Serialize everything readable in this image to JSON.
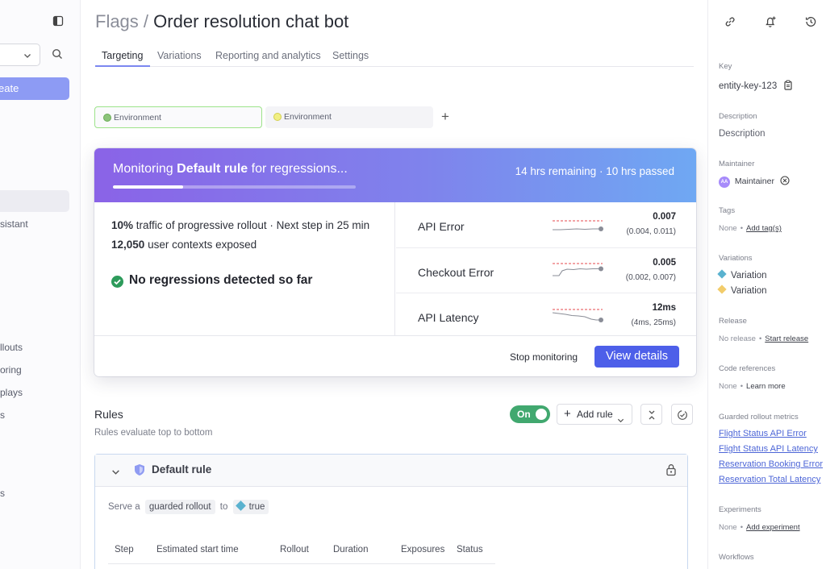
{
  "sidebar": {
    "create_label": "eate",
    "items": [
      "sistant",
      "llouts",
      "oring",
      "plays",
      "s",
      "s"
    ]
  },
  "header": {
    "breadcrumb": "Flags /",
    "title": "Order resolution chat bot",
    "tabs": [
      "Targeting",
      "Variations",
      "Reporting and analytics",
      "Settings"
    ]
  },
  "environments": [
    {
      "label": "Environment",
      "color": "#8cc47a"
    },
    {
      "label": "Environment",
      "color": "#f1ef83"
    }
  ],
  "monitoring": {
    "title_prefix": "Monitoring",
    "title_bold": "Default rule",
    "title_suffix": "for regressions...",
    "remaining": "14 hrs remaining · 10 hrs passed",
    "progress": 0.29,
    "traffic_bold": "10%",
    "traffic_text": "traffic of progressive rollout · Next step in 25 min",
    "contexts_bold": "12,050",
    "contexts_text": "user contexts exposed",
    "status": "No regressions detected so far",
    "metrics": [
      {
        "name": "API Error",
        "value": "0.007",
        "ci": "(0.004, 0.011)"
      },
      {
        "name": "Checkout Error",
        "value": "0.005",
        "ci": "(0.002, 0.007)"
      },
      {
        "name": "API Latency",
        "value": "12ms",
        "ci": "(4ms, 25ms)"
      }
    ],
    "stop_label": "Stop monitoring",
    "view_label": "View details"
  },
  "rules": {
    "title": "Rules",
    "subtitle": "Rules evaluate top to bottom",
    "toggle_label": "On",
    "add_rule_label": "Add rule",
    "default_rule": {
      "name": "Default rule",
      "serve_prefix": "Serve a",
      "serve_type": "guarded rollout",
      "serve_to": "to",
      "serve_value": "true"
    },
    "columns": [
      "Step",
      "Estimated start time",
      "Rollout",
      "Duration",
      "Exposures",
      "Status"
    ]
  },
  "details": {
    "key_label": "Key",
    "key_value": "entity-key-123",
    "description_label": "Description",
    "description_value": "Description",
    "maintainer_label": "Maintainer",
    "maintainer_initials": "AA",
    "maintainer_value": "Maintainer",
    "tags_label": "Tags",
    "tags_none": "None",
    "tags_link": "Add tag(s)",
    "variations_label": "Variations",
    "variations": [
      {
        "label": "Variation",
        "color": "#5ab2cf"
      },
      {
        "label": "Variation",
        "color": "#f2cc6b"
      }
    ],
    "release_label": "Release",
    "release_none": "No release",
    "release_link": "Start release",
    "code_label": "Code references",
    "code_none": "None",
    "code_link": "Learn more",
    "guarded_label": "Guarded rollout metrics",
    "guarded_metrics": [
      "Flight Status API Error",
      "Flight Status API Latency",
      "Reservation Booking Error",
      "Reservation Total Latency"
    ],
    "experiments_label": "Experiments",
    "experiments_none": "None",
    "experiments_link": "Add experiment",
    "workflows_label": "Workflows"
  },
  "colors": {
    "accent": "#4d5fe9",
    "success": "#2d9b5b",
    "toggle_on": "#41a86f",
    "link": "#4d66d7"
  }
}
